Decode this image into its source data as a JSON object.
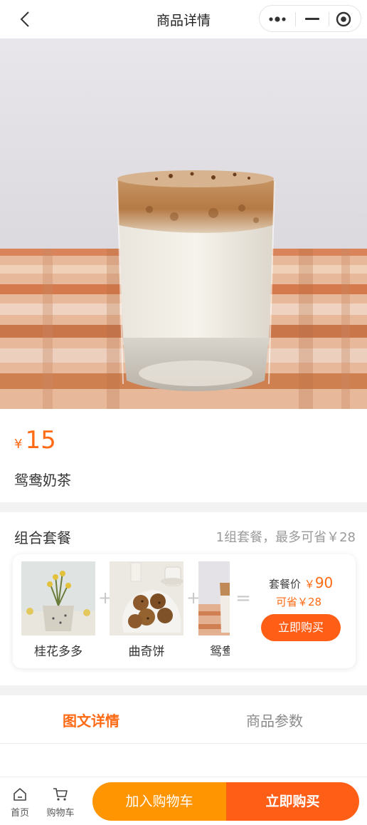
{
  "nav": {
    "title": "商品详情"
  },
  "product": {
    "currency": "¥",
    "price": "15",
    "name": "鸳鸯奶茶"
  },
  "combo": {
    "title": "组合套餐",
    "info": "1组套餐，最多可省￥28",
    "items": [
      {
        "name": "桂花多多"
      },
      {
        "name": "曲奇饼"
      },
      {
        "name": "鸳鸯"
      }
    ],
    "plus": "+",
    "equals": "=",
    "price_label": "套餐价",
    "price_currency": "￥",
    "price_value": "90",
    "save_label": "可省￥28",
    "buy_label": "立即购买"
  },
  "tabs": [
    {
      "label": "图文详情",
      "active": true
    },
    {
      "label": "商品参数",
      "active": false
    }
  ],
  "bottom_bar": {
    "home_label": "首页",
    "cart_label": "购物车",
    "add_to_cart": "加入购物车",
    "buy_now": "立即购买"
  },
  "colors": {
    "accent": "#ff6a14",
    "cart_button": "#ff9500",
    "buy_button": "#ff5e17"
  }
}
